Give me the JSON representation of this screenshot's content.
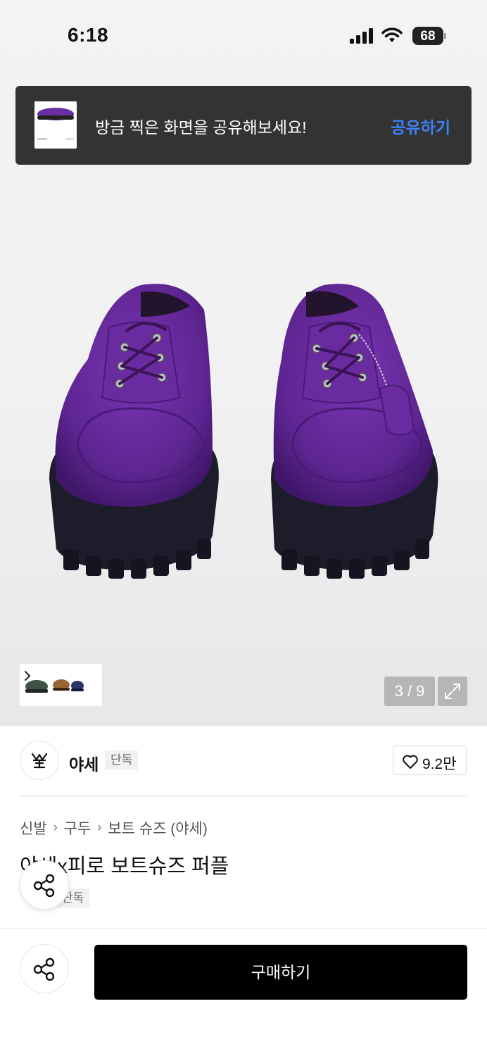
{
  "status_bar": {
    "time": "6:18",
    "battery": "68"
  },
  "toast": {
    "message": "방금 찍은 화면을 공유해보세요!",
    "action": "공유하기",
    "action_color": "#3b82f6"
  },
  "gallery": {
    "page_indicator": "3 / 9",
    "current_page": 3,
    "total_pages": 9,
    "product_color": "#6a2aa0"
  },
  "brand": {
    "name": "야세",
    "badge": "단독"
  },
  "likes": {
    "count": "9.2만"
  },
  "breadcrumb": {
    "items": [
      "신발",
      "구두",
      "보트 슈즈 (야세)"
    ]
  },
  "product": {
    "title": "야세x피로 보트슈즈 퍼플",
    "badge": "단독"
  },
  "bottom_bar": {
    "buy_label": "구매하기"
  }
}
